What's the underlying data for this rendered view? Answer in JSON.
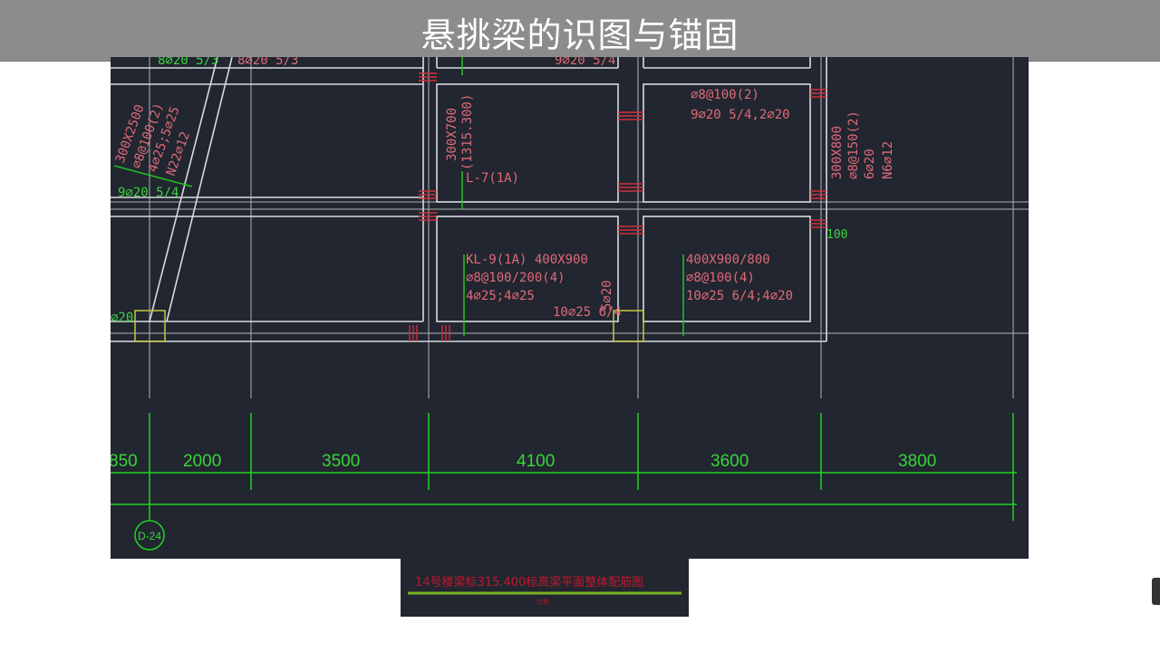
{
  "title": "悬挑梁的识图与锚固",
  "annotations": {
    "top_left_green": "8⌀20 5/3",
    "top_left_red": "8⌀20 5/3",
    "top_mid": "9⌀20 5/4",
    "diag_1": "300X2500",
    "diag_2": "⌀8@100(2)",
    "diag_3": "4⌀25;5⌀25",
    "diag_4": "N22⌀12",
    "diag_green": "9⌀20 5/4",
    "left_green": "⌀20",
    "l7_size": "300X700",
    "l7_elev": "(1315.300)",
    "l7_name": "L-7(1A)",
    "tr_1": "⌀8@100(2)",
    "tr_2": "9⌀20 5/4,2⌀20",
    "right_1": "300X800",
    "right_2": "⌀8@150(2)",
    "right_3": "6⌀20",
    "right_4": "N6⌀12",
    "right_green": "100",
    "kl9_1": "KL-9(1A) 400X900",
    "kl9_2": "⌀8@100/200(4)",
    "kl9_3": "4⌀25;4⌀25",
    "kl9_4": "10⌀25 6/4",
    "kl9_5": "5⌀20",
    "br_1": "400X900/800",
    "br_2": "⌀8@100(4)",
    "br_3": "10⌀25 6/4;4⌀20"
  },
  "dimensions": [
    "850",
    "2000",
    "3500",
    "4100",
    "3600",
    "3800"
  ],
  "axis_label": "D-24",
  "drawing_title": "14号楼梁标315.400标高梁平面整体配筋图",
  "drawing_scale": "比例"
}
